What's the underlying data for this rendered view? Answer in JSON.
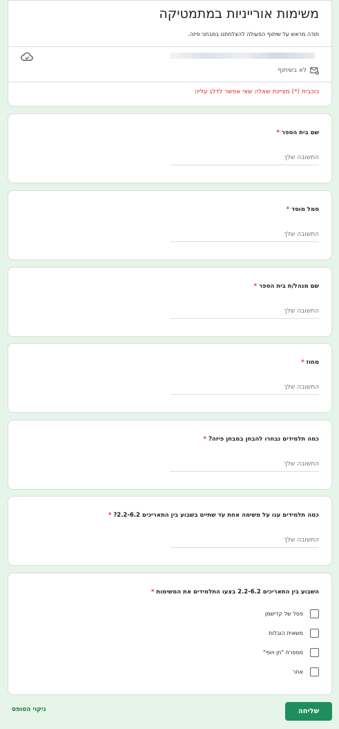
{
  "header": {
    "title": "משימות אורייניות במתמטיקה",
    "description": "תודה מראש על שיתוף הפעולה להצלחתנו במבחני פיזה.",
    "not_shared": "לא בשיתוף",
    "required_note": "כוכבית (*) מציינת שאלה שאי אפשר לדלג עליה"
  },
  "questions": [
    {
      "title": "שם בית הספר",
      "placeholder": "התשובה שלך"
    },
    {
      "title": "סמל מוסד",
      "placeholder": "התשובה שלך"
    },
    {
      "title": "שם מנהל/ת בית הספר",
      "placeholder": "התשובה שלך"
    },
    {
      "title": "מחוז",
      "placeholder": "התשובה שלך"
    },
    {
      "title": "כמה תלמידים נבחרו להבחן במבחן פיזה?",
      "placeholder": "התשובה שלך"
    },
    {
      "title": "כמה תלמידים ענו על משימה אחת עד שתיים בשבוע בין התאריכים 2.2-6.2?",
      "placeholder": "התשובה שלך"
    }
  ],
  "checkbox_question": {
    "title": "השבוע בין התאריכים 2.2-6.2 בצעו התלמידים את המשימות",
    "options": [
      "פסל של קדישמן",
      "משאית הובלות",
      "מספרת \"חן ויופי\"",
      "אחר"
    ]
  },
  "footer": {
    "submit_label": "שליחה",
    "clear_label": "ניקוי הטופס"
  },
  "colors": {
    "background": "#e6f4ea",
    "accent": "#1e8e5e",
    "required": "#d93025"
  }
}
